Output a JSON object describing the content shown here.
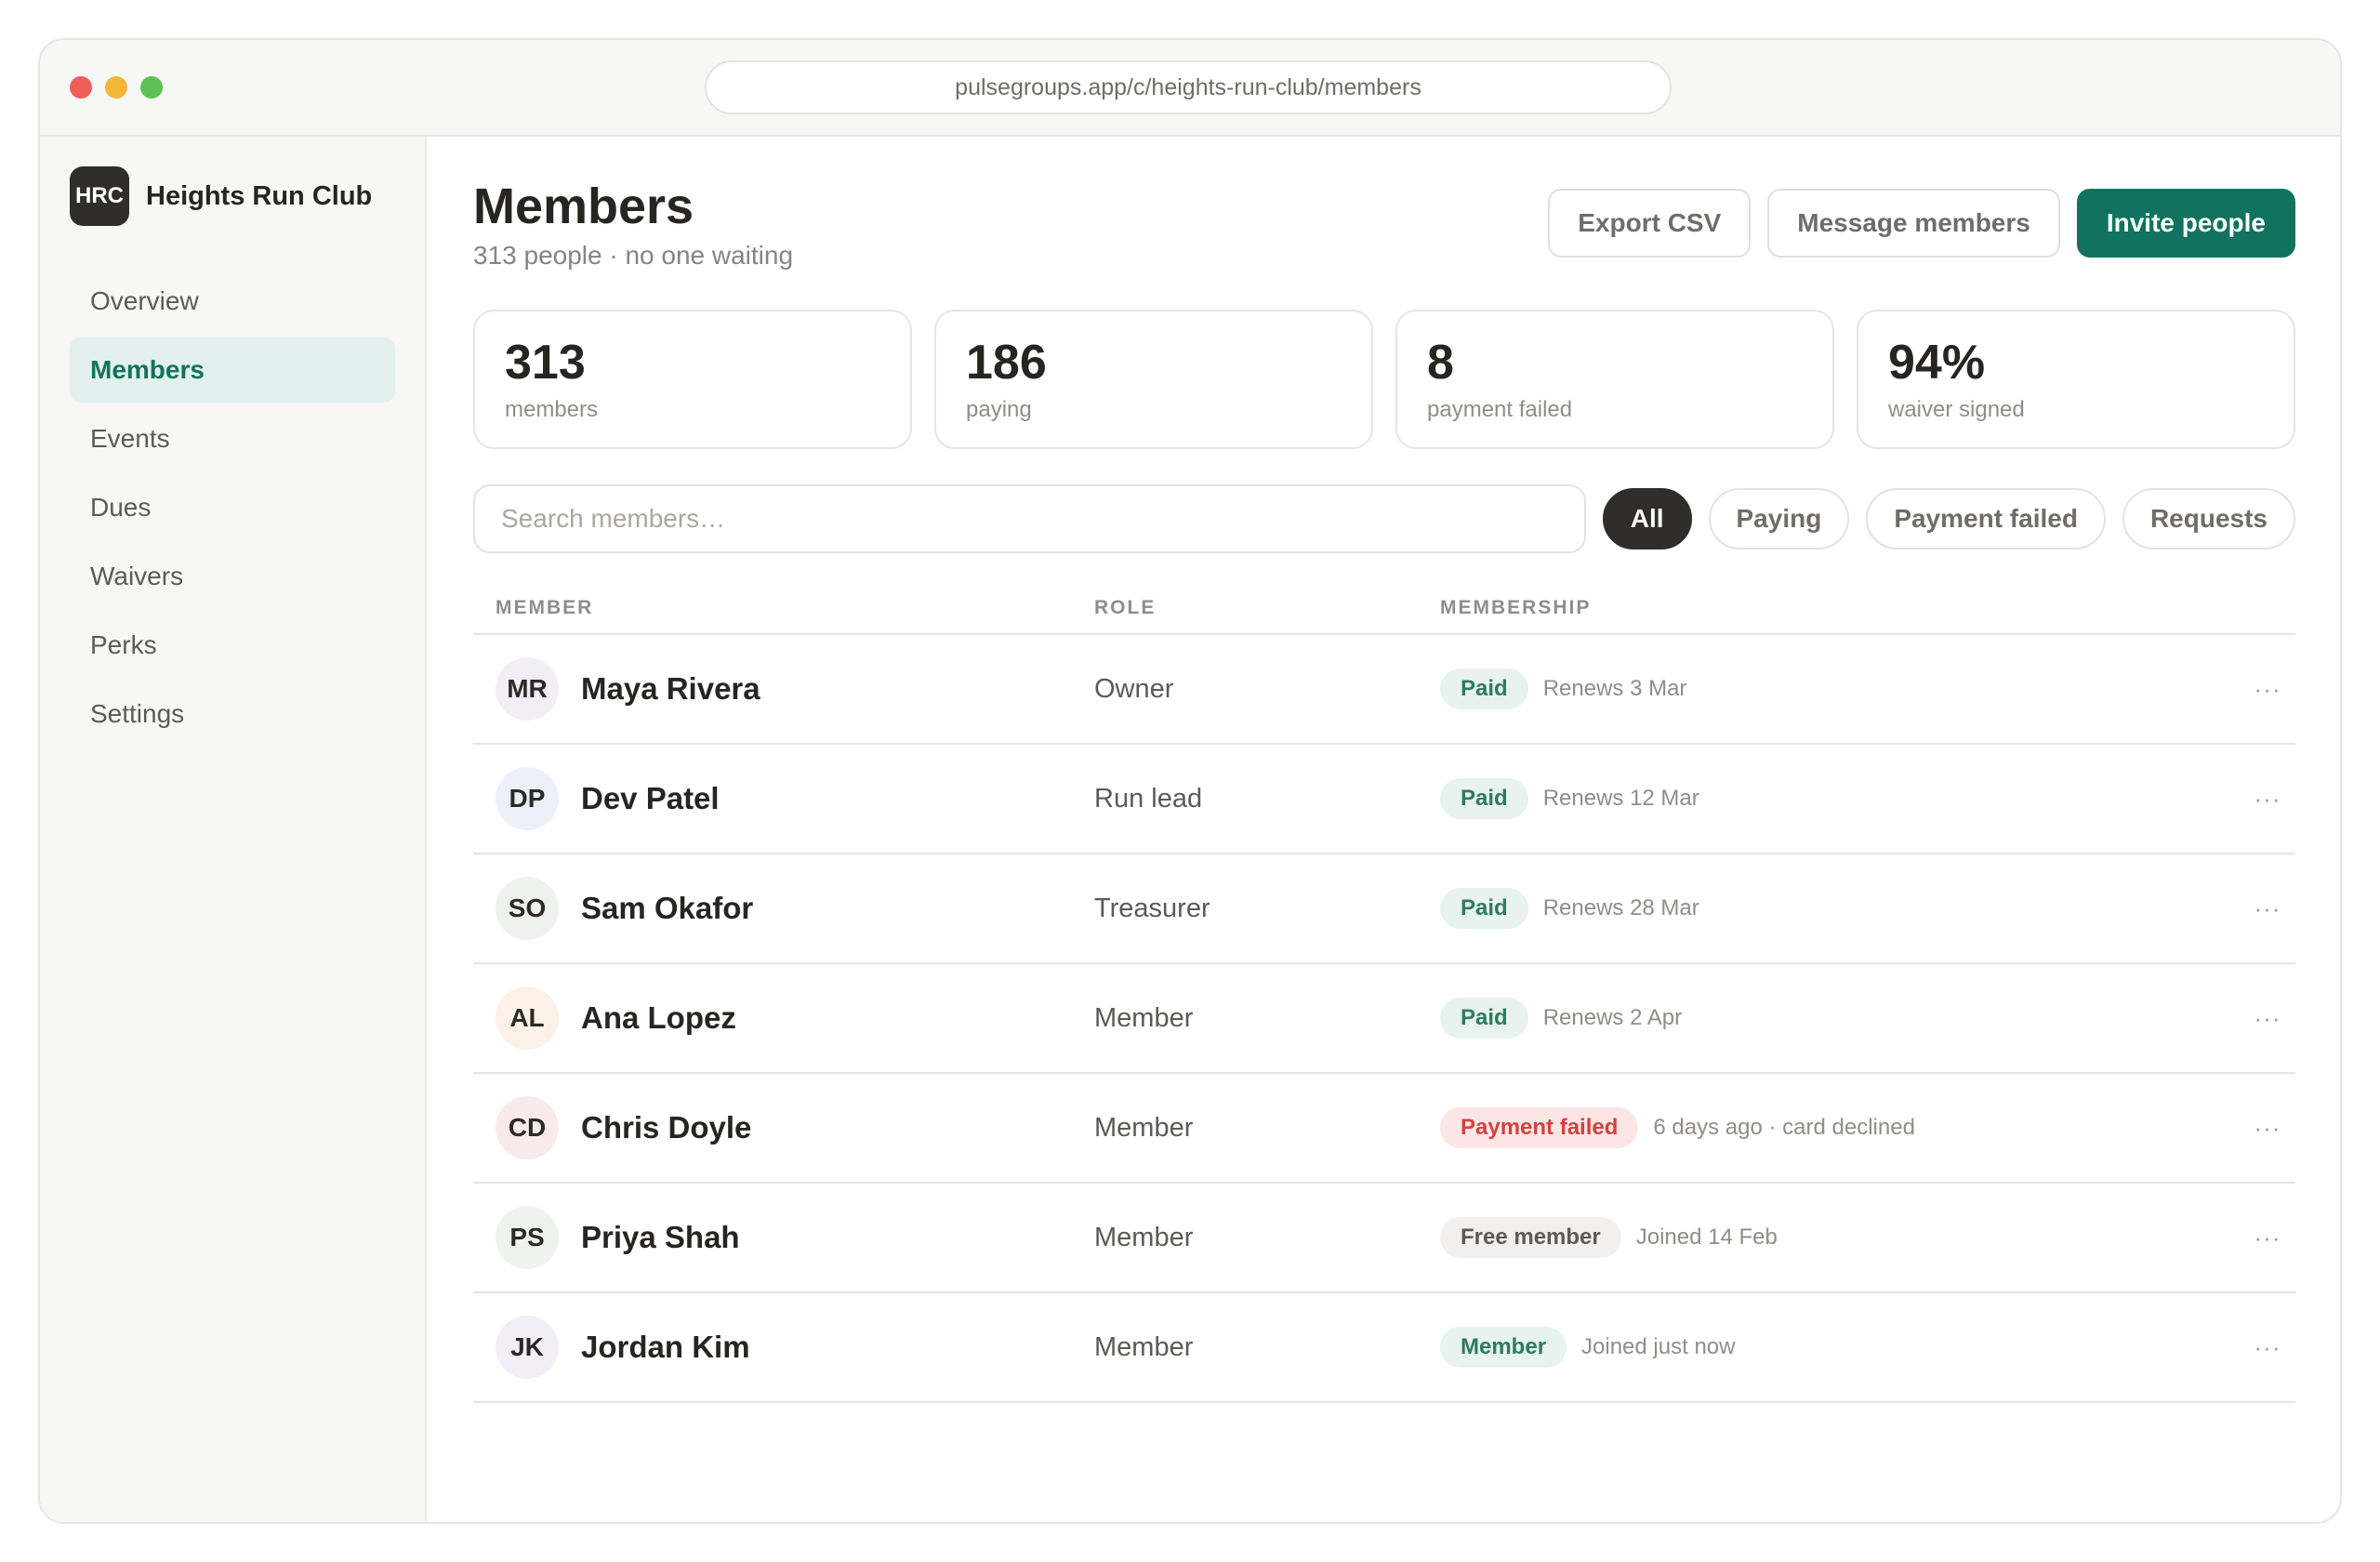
{
  "browser": {
    "url": "pulsegroups.app/c/heights-run-club/members"
  },
  "sidebar": {
    "club_initials": "HRC",
    "club_name": "Heights Run Club",
    "items": [
      {
        "label": "Overview",
        "active": false
      },
      {
        "label": "Members",
        "active": true
      },
      {
        "label": "Events",
        "active": false
      },
      {
        "label": "Dues",
        "active": false
      },
      {
        "label": "Waivers",
        "active": false
      },
      {
        "label": "Perks",
        "active": false
      },
      {
        "label": "Settings",
        "active": false
      }
    ]
  },
  "header": {
    "title": "Members",
    "subtitle": "313 people · no one waiting",
    "export_label": "Export CSV",
    "message_label": "Message members",
    "invite_label": "Invite people"
  },
  "stats": [
    {
      "value": "313",
      "label": "members"
    },
    {
      "value": "186",
      "label": "paying"
    },
    {
      "value": "8",
      "label": "payment failed"
    },
    {
      "value": "94%",
      "label": "waiver signed"
    }
  ],
  "search": {
    "placeholder": "Search members…",
    "value": ""
  },
  "filters": [
    {
      "label": "All",
      "active": true
    },
    {
      "label": "Paying",
      "active": false
    },
    {
      "label": "Payment failed",
      "active": false
    },
    {
      "label": "Requests",
      "active": false
    }
  ],
  "table": {
    "columns": {
      "member": "MEMBER",
      "role": "ROLE",
      "membership": "MEMBERSHIP"
    },
    "rows": [
      {
        "initials": "MR",
        "name": "Maya Rivera",
        "role": "Owner",
        "status": "Paid",
        "status_kind": "paid",
        "detail": "Renews 3 Mar",
        "avatar_color": "#f1eef8"
      },
      {
        "initials": "DP",
        "name": "Dev Patel",
        "role": "Run lead",
        "status": "Paid",
        "status_kind": "paid",
        "detail": "Renews 12 Mar",
        "avatar_color": "#ebf1f8"
      },
      {
        "initials": "SO",
        "name": "Sam Okafor",
        "role": "Treasurer",
        "status": "Paid",
        "status_kind": "paid",
        "detail": "Renews 28 Mar",
        "avatar_color": "#eff1ee"
      },
      {
        "initials": "AL",
        "name": "Ana Lopez",
        "role": "Member",
        "status": "Paid",
        "status_kind": "paid",
        "detail": "Renews 2 Apr",
        "avatar_color": "#fbf1e6"
      },
      {
        "initials": "CD",
        "name": "Chris Doyle",
        "role": "Member",
        "status": "Payment failed",
        "status_kind": "failed",
        "detail": "6 days ago · card declined",
        "avatar_color": "#fbeaea"
      },
      {
        "initials": "PS",
        "name": "Priya Shah",
        "role": "Member",
        "status": "Free member",
        "status_kind": "free",
        "detail": "Joined 14 Feb",
        "avatar_color": "#eef3ed"
      },
      {
        "initials": "JK",
        "name": "Jordan Kim",
        "role": "Member",
        "status": "Member",
        "status_kind": "member",
        "detail": "Joined just now",
        "avatar_color": "#f1eef8"
      }
    ],
    "row_action_icon": "more-horizontal-icon"
  }
}
